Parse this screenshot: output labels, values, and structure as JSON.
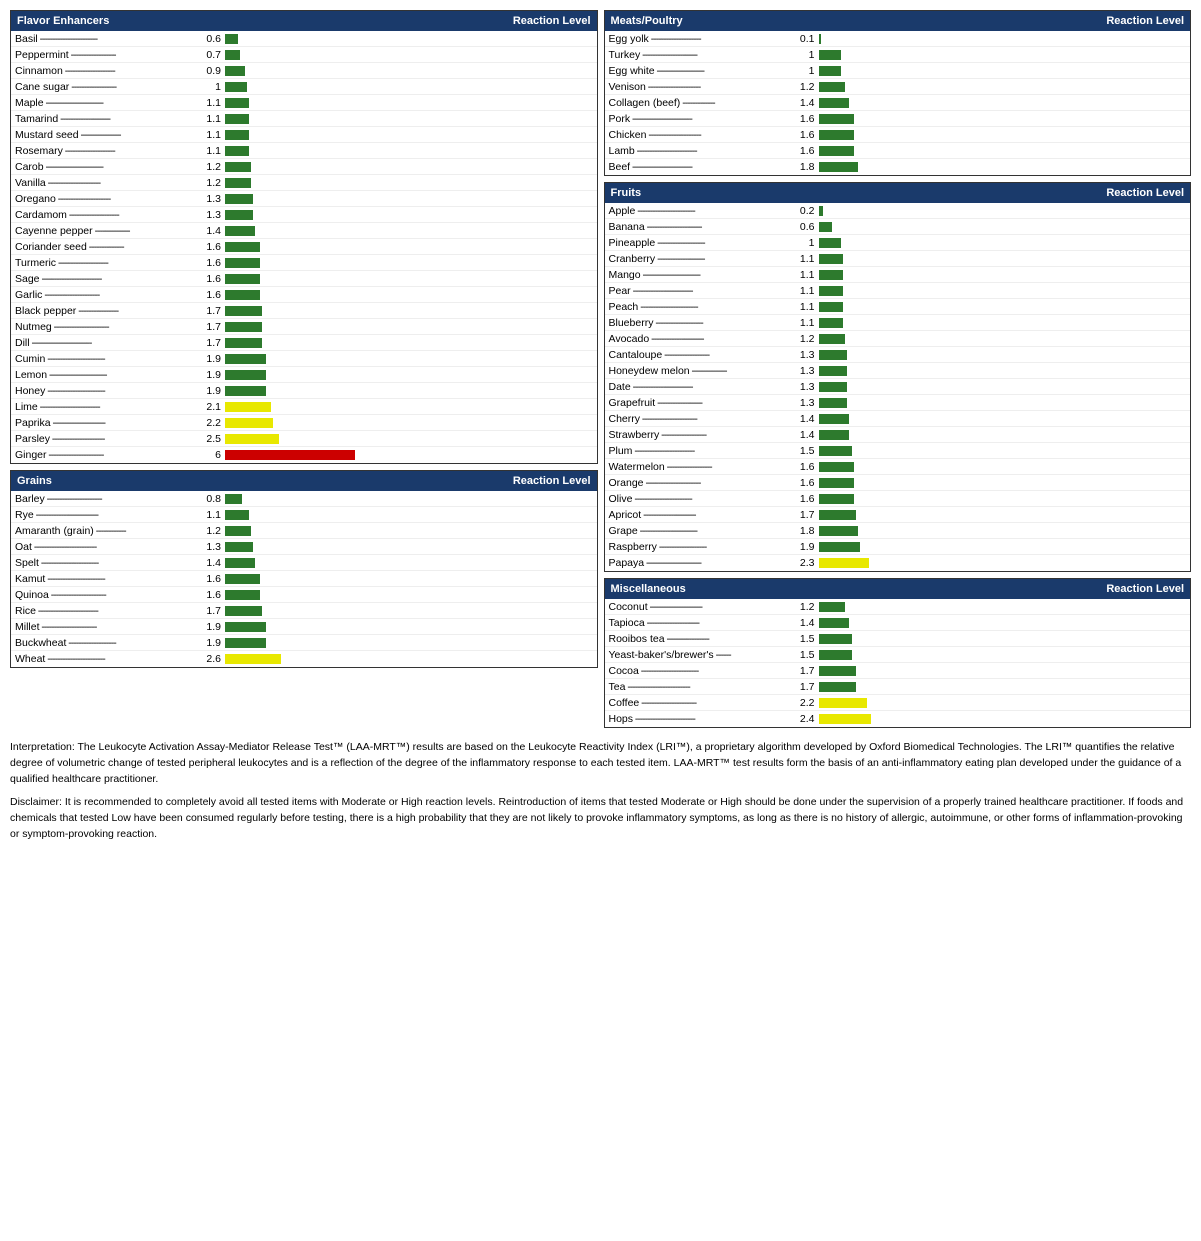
{
  "sections": {
    "flavor_enhancers": {
      "title": "Flavor Enhancers",
      "col": "Reaction Level",
      "max_bar": 150,
      "items": [
        {
          "name": "Basil",
          "value": 0.6,
          "color": "green"
        },
        {
          "name": "Peppermint",
          "value": 0.7,
          "color": "green"
        },
        {
          "name": "Cinnamon",
          "value": 0.9,
          "color": "green"
        },
        {
          "name": "Cane sugar",
          "value": 1.0,
          "color": "green"
        },
        {
          "name": "Maple",
          "value": 1.1,
          "color": "green"
        },
        {
          "name": "Tamarind",
          "value": 1.1,
          "color": "green"
        },
        {
          "name": "Mustard seed",
          "value": 1.1,
          "color": "green"
        },
        {
          "name": "Rosemary",
          "value": 1.1,
          "color": "green"
        },
        {
          "name": "Carob",
          "value": 1.2,
          "color": "green"
        },
        {
          "name": "Vanilla",
          "value": 1.2,
          "color": "green"
        },
        {
          "name": "Oregano",
          "value": 1.3,
          "color": "green"
        },
        {
          "name": "Cardamom",
          "value": 1.3,
          "color": "green"
        },
        {
          "name": "Cayenne pepper",
          "value": 1.4,
          "color": "green"
        },
        {
          "name": "Coriander seed",
          "value": 1.6,
          "color": "green"
        },
        {
          "name": "Turmeric",
          "value": 1.6,
          "color": "green"
        },
        {
          "name": "Sage",
          "value": 1.6,
          "color": "green"
        },
        {
          "name": "Garlic",
          "value": 1.6,
          "color": "green"
        },
        {
          "name": "Black pepper",
          "value": 1.7,
          "color": "green"
        },
        {
          "name": "Nutmeg",
          "value": 1.7,
          "color": "green"
        },
        {
          "name": "Dill",
          "value": 1.7,
          "color": "green"
        },
        {
          "name": "Cumin",
          "value": 1.9,
          "color": "green"
        },
        {
          "name": "Lemon",
          "value": 1.9,
          "color": "green"
        },
        {
          "name": "Honey",
          "value": 1.9,
          "color": "green"
        },
        {
          "name": "Lime",
          "value": 2.1,
          "color": "yellow"
        },
        {
          "name": "Paprika",
          "value": 2.2,
          "color": "yellow"
        },
        {
          "name": "Parsley",
          "value": 2.5,
          "color": "yellow"
        },
        {
          "name": "Ginger",
          "value": 6.0,
          "color": "red"
        }
      ]
    },
    "grains": {
      "title": "Grains",
      "col": "Reaction Level",
      "max_bar": 150,
      "items": [
        {
          "name": "Barley",
          "value": 0.8,
          "color": "green"
        },
        {
          "name": "Rye",
          "value": 1.1,
          "color": "green"
        },
        {
          "name": "Amaranth (grain)",
          "value": 1.2,
          "color": "green"
        },
        {
          "name": "Oat",
          "value": 1.3,
          "color": "green"
        },
        {
          "name": "Spelt",
          "value": 1.4,
          "color": "green"
        },
        {
          "name": "Kamut",
          "value": 1.6,
          "color": "green"
        },
        {
          "name": "Quinoa",
          "value": 1.6,
          "color": "green"
        },
        {
          "name": "Rice",
          "value": 1.7,
          "color": "green"
        },
        {
          "name": "Millet",
          "value": 1.9,
          "color": "green"
        },
        {
          "name": "Buckwheat",
          "value": 1.9,
          "color": "green"
        },
        {
          "name": "Wheat",
          "value": 2.6,
          "color": "yellow"
        }
      ]
    },
    "meats_poultry": {
      "title": "Meats/Poultry",
      "col": "Reaction Level",
      "max_bar": 150,
      "items": [
        {
          "name": "Egg yolk",
          "value": 0.1,
          "color": "green"
        },
        {
          "name": "Turkey",
          "value": 1.0,
          "color": "green"
        },
        {
          "name": "Egg white",
          "value": 1.0,
          "color": "green"
        },
        {
          "name": "Venison",
          "value": 1.2,
          "color": "green"
        },
        {
          "name": "Collagen (beef)",
          "value": 1.4,
          "color": "green"
        },
        {
          "name": "Pork",
          "value": 1.6,
          "color": "green"
        },
        {
          "name": "Chicken",
          "value": 1.6,
          "color": "green"
        },
        {
          "name": "Lamb",
          "value": 1.6,
          "color": "green"
        },
        {
          "name": "Beef",
          "value": 1.8,
          "color": "green"
        }
      ]
    },
    "fruits": {
      "title": "Fruits",
      "col": "Reaction Level",
      "max_bar": 150,
      "items": [
        {
          "name": "Apple",
          "value": 0.2,
          "color": "green"
        },
        {
          "name": "Banana",
          "value": 0.6,
          "color": "green"
        },
        {
          "name": "Pineapple",
          "value": 1.0,
          "color": "green"
        },
        {
          "name": "Cranberry",
          "value": 1.1,
          "color": "green"
        },
        {
          "name": "Mango",
          "value": 1.1,
          "color": "green"
        },
        {
          "name": "Pear",
          "value": 1.1,
          "color": "green"
        },
        {
          "name": "Peach",
          "value": 1.1,
          "color": "green"
        },
        {
          "name": "Blueberry",
          "value": 1.1,
          "color": "green"
        },
        {
          "name": "Avocado",
          "value": 1.2,
          "color": "green"
        },
        {
          "name": "Cantaloupe",
          "value": 1.3,
          "color": "green"
        },
        {
          "name": "Honeydew melon",
          "value": 1.3,
          "color": "green"
        },
        {
          "name": "Date",
          "value": 1.3,
          "color": "green"
        },
        {
          "name": "Grapefruit",
          "value": 1.3,
          "color": "green"
        },
        {
          "name": "Cherry",
          "value": 1.4,
          "color": "green"
        },
        {
          "name": "Strawberry",
          "value": 1.4,
          "color": "green"
        },
        {
          "name": "Plum",
          "value": 1.5,
          "color": "green"
        },
        {
          "name": "Watermelon",
          "value": 1.6,
          "color": "green"
        },
        {
          "name": "Orange",
          "value": 1.6,
          "color": "green"
        },
        {
          "name": "Olive",
          "value": 1.6,
          "color": "green"
        },
        {
          "name": "Apricot",
          "value": 1.7,
          "color": "green"
        },
        {
          "name": "Grape",
          "value": 1.8,
          "color": "green"
        },
        {
          "name": "Raspberry",
          "value": 1.9,
          "color": "green"
        },
        {
          "name": "Papaya",
          "value": 2.3,
          "color": "yellow"
        }
      ]
    },
    "miscellaneous": {
      "title": "Miscellaneous",
      "col": "Reaction Level",
      "max_bar": 150,
      "items": [
        {
          "name": "Coconut",
          "value": 1.2,
          "color": "green"
        },
        {
          "name": "Tapioca",
          "value": 1.4,
          "color": "green"
        },
        {
          "name": "Rooibos tea",
          "value": 1.5,
          "color": "green"
        },
        {
          "name": "Yeast-baker's/brewer's",
          "value": 1.5,
          "color": "green"
        },
        {
          "name": "Cocoa",
          "value": 1.7,
          "color": "green"
        },
        {
          "name": "Tea",
          "value": 1.7,
          "color": "green"
        },
        {
          "name": "Coffee",
          "value": 2.2,
          "color": "yellow"
        },
        {
          "name": "Hops",
          "value": 2.4,
          "color": "yellow"
        }
      ]
    }
  },
  "interpretation": {
    "para1": "Interpretation: The Leukocyte Activation Assay-Mediator Release Test™ (LAA-MRT™) results are based on the Leukocyte Reactivity Index (LRI™), a proprietary algorithm developed by Oxford Biomedical Technologies. The LRI™ quantifies the relative degree of volumetric change of tested peripheral leukocytes and is a reflection of the degree of the inflammatory response to each tested item. LAA-MRT™ test results form the basis of an anti-inflammatory eating plan developed under the guidance of a qualified healthcare practitioner.",
    "para2": "Disclaimer: It is recommended to completely avoid all tested items with Moderate or High reaction levels. Reintroduction of items that tested Moderate or High should be done under the supervision of a properly trained healthcare practitioner. If foods and chemicals that tested Low have been consumed regularly before testing, there is a high probability that they are not likely to provoke inflammatory symptoms, as long as there is no history of allergic, autoimmune, or other forms of inflammation-provoking or symptom-provoking reaction."
  }
}
